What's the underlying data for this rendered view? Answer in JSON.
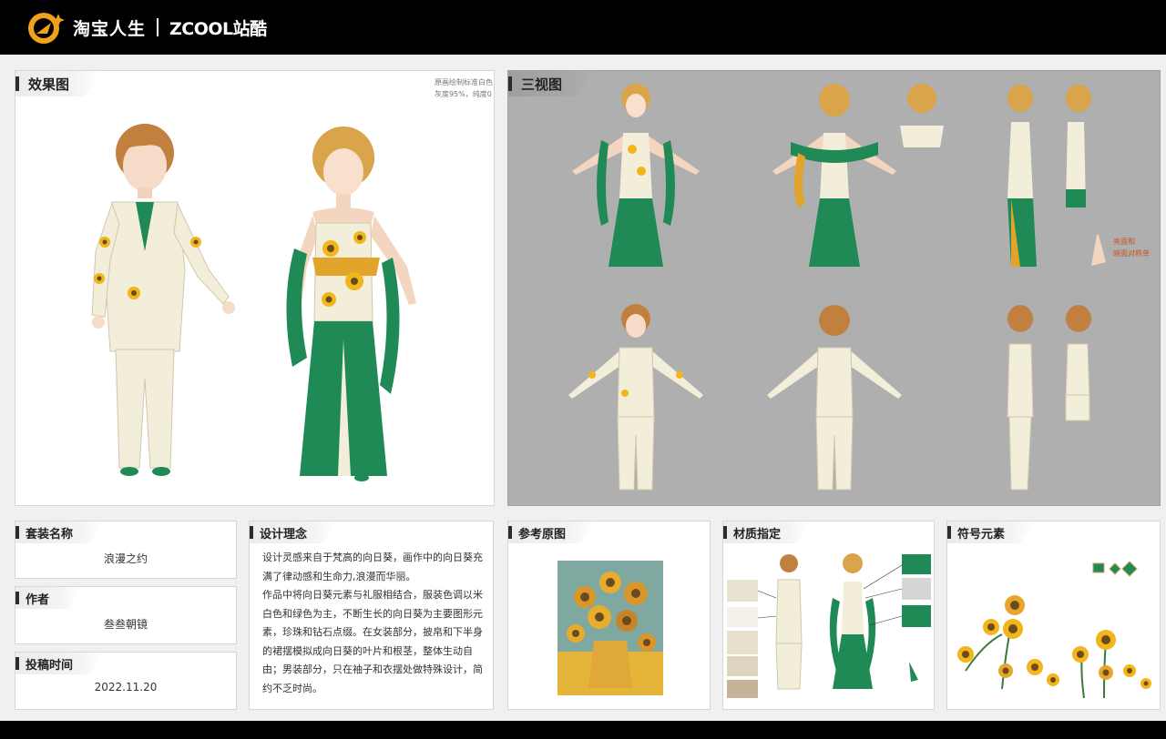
{
  "header": {
    "brand_cn": "淘宝人生",
    "brand_zcool": "ZCOOL站酷"
  },
  "panels": {
    "render": {
      "title": "效果图",
      "note_line1": "原画绘制标准白色",
      "note_line2": "灰度95%，纯度0"
    },
    "three_view": {
      "title": "三视图",
      "note_line1": "亮面和",
      "note_line2": "暗面对称单"
    },
    "outfit_name": {
      "label": "套装名称",
      "value": "浪漫之约"
    },
    "author": {
      "label": "作者",
      "value": "叁叁朝镜"
    },
    "submit_time": {
      "label": "投稿时间",
      "value": "2022.11.20"
    },
    "concept": {
      "label": "设计理念",
      "paragraph1": "设计灵感来自于梵高的向日葵，画作中的向日葵充满了律动感和生命力,浪漫而华丽。",
      "paragraph2": "作品中将向日葵元素与礼服相结合，服装色调以米白色和绿色为主，不断生长的向日葵为主要图形元素，珍珠和钻石点缀。在女装部分，披帛和下半身的裙摆模拟成向日葵的叶片和根茎，整体生动自由；男装部分，只在袖子和衣摆处做特殊设计，简约不乏时尚。"
    },
    "reference": {
      "label": "参考原图"
    },
    "materials": {
      "label": "材质指定"
    },
    "symbols": {
      "label": "符号元素"
    }
  },
  "colors": {
    "header_bg": "#000000",
    "panel_bg": "#ffffff",
    "three_view_bg": "#afafaf",
    "dress_green": "#1f8a55",
    "suit_cream": "#f2eeda",
    "sunflower_yellow": "#f2b51a",
    "hair_gold": "#d9a44a",
    "hair_brown": "#c2803f"
  }
}
